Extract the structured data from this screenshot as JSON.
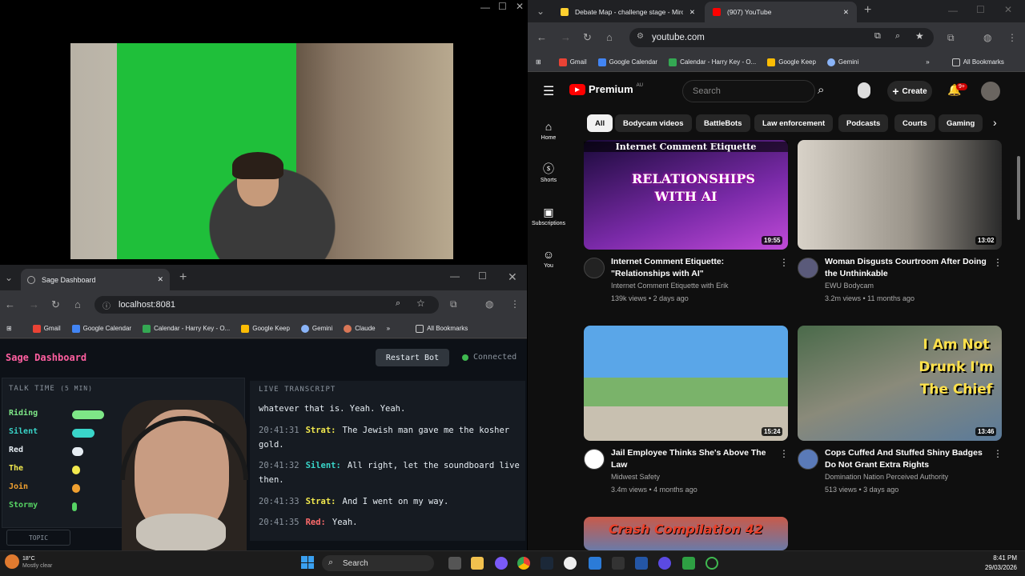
{
  "sage": {
    "tab_title": "Sage Dashboard",
    "url": "localhost:8081",
    "bookmarks": [
      "Gmail",
      "Google Calendar",
      "Calendar - Harry Key - O...",
      "Google Keep",
      "Gemini",
      "Claude"
    ],
    "all_bookmarks": "All Bookmarks",
    "title": "Sage Dashboard",
    "restart_label": "Restart Bot",
    "status": "Connected",
    "talk_time_title": "TALK TIME",
    "talk_time_unit": "(5 MIN)",
    "speakers": [
      {
        "name": "Riding",
        "color": "#7ee787",
        "fill": 0.57
      },
      {
        "name": "Silent",
        "color": "#39d5c9",
        "fill": 0.4
      },
      {
        "name": "Red",
        "color": "#e6edf3",
        "fill": 0.2
      },
      {
        "name": "The",
        "color": "#f2e94e",
        "fill": 0.14
      },
      {
        "name": "Join",
        "color": "#f0a030",
        "fill": 0.14
      },
      {
        "name": "Stormy",
        "color": "#56d364",
        "fill": 0.06
      }
    ],
    "transcript_title": "LIVE TRANSCRIPT",
    "transcript": [
      {
        "time": "",
        "speaker": "",
        "color": "#e6edf3",
        "text": "whatever that is. Yeah. Yeah."
      },
      {
        "time": "20:41:31",
        "speaker": "Strat:",
        "color": "#f2e94e",
        "text": "The Jewish man gave me the kosher gold."
      },
      {
        "time": "20:41:32",
        "speaker": "Silent:",
        "color": "#39d5c9",
        "text": "All right, let the soundboard live then."
      },
      {
        "time": "20:41:33",
        "speaker": "Strat:",
        "color": "#f2e94e",
        "text": "And I went on my way."
      },
      {
        "time": "20:41:35",
        "speaker": "Red:",
        "color": "#ff6b6b",
        "text": "Yeah."
      }
    ],
    "topic_label": "TOPIC"
  },
  "youtube": {
    "tabs": [
      {
        "label": "Debate Map - challenge stage - Miro",
        "active": false
      },
      {
        "label": "(907) YouTube",
        "active": true
      }
    ],
    "url": "youtube.com",
    "bookmarks": [
      "Gmail",
      "Google Calendar",
      "Calendar - Harry Key - O...",
      "Google Keep",
      "Gemini"
    ],
    "all_bookmarks": "All Bookmarks",
    "logo": "Premium",
    "region": "AU",
    "search_placeholder": "Search",
    "create_label": "Create",
    "notif_count": "9+",
    "chips": [
      "All",
      "Bodycam videos",
      "BattleBots",
      "Law enforcement",
      "Podcasts",
      "Courts",
      "Gaming"
    ],
    "sidebar": [
      "Home",
      "Shorts",
      "Subscriptions",
      "You"
    ],
    "videos": [
      {
        "title": "Internet Comment Etiquette: \"Relationships with AI\"",
        "channel": "Internet Comment Etiquette with Erik",
        "meta": "139k views • 2 days ago",
        "duration": "19:55",
        "thumb_text": "RELATIONSHIPS WITH AI",
        "thumb_top": "Internet Comment Etiquette"
      },
      {
        "title": "Woman Disgusts Courtroom After Doing the Unthinkable",
        "channel": "EWU Bodycam",
        "meta": "3.2m views • 11 months ago",
        "duration": "13:02",
        "thumb_text": ""
      },
      {
        "title": "Jail Employee Thinks She's Above The Law",
        "channel": "Midwest Safety",
        "meta": "3.4m views • 4 months ago",
        "duration": "15:24",
        "thumb_text": ""
      },
      {
        "title": "Cops Cuffed And Stuffed Shiny Badges Do Not Grant Extra Rights",
        "channel": "Domination Nation Perceived Authority",
        "meta": "513 views • 3 days ago",
        "duration": "13:46",
        "thumb_text": "I Am Not Drunk I'm The Chief"
      },
      {
        "title": "",
        "channel": "",
        "meta": "",
        "duration": "",
        "thumb_text": "Crash Compilation 42"
      }
    ]
  },
  "taskbar": {
    "search": "Search",
    "time": "8:41 PM",
    "date": "29/03/2026",
    "weather_temp": "18°C",
    "weather_desc": "Mostly clear"
  }
}
